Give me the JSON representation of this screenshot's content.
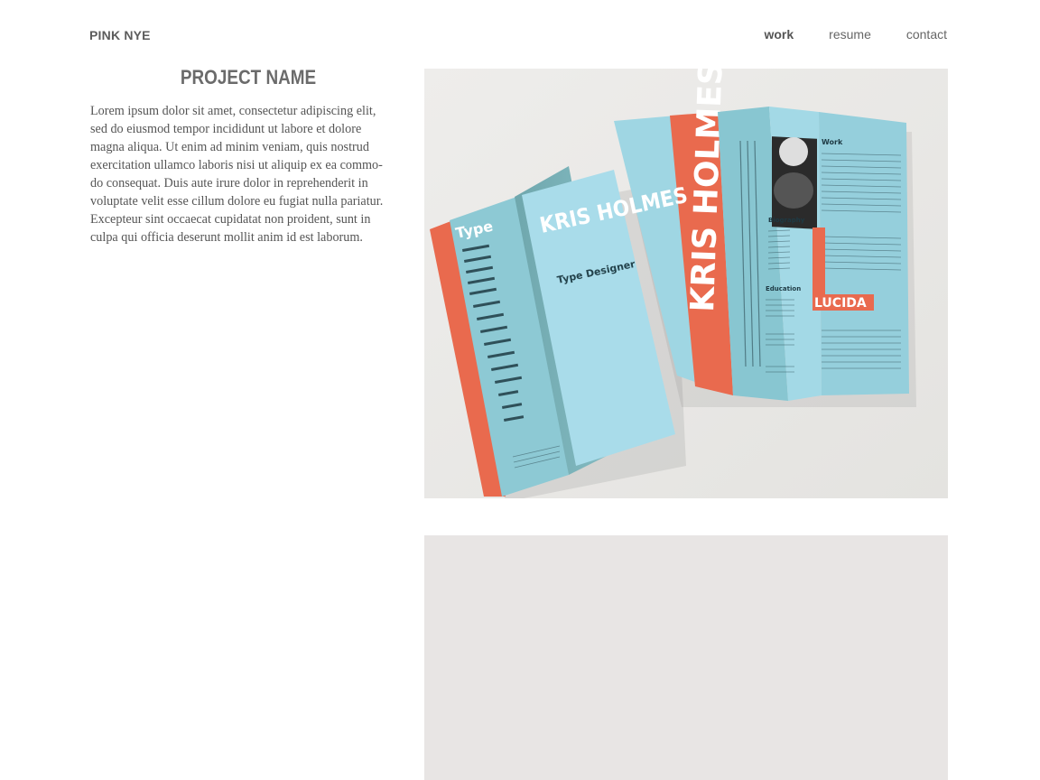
{
  "header": {
    "logo": "PINK NYE",
    "nav": [
      {
        "label": "work",
        "active": true
      },
      {
        "label": "resume",
        "active": false
      },
      {
        "label": "contact",
        "active": false
      }
    ]
  },
  "project": {
    "title": "PROJECT NAME",
    "description": "Lorem ipsum dolor sit amet, consectetur adipiscing elit, sed do eiusmod tempor incididunt ut labore et dolore magna aliqua. Ut enim ad minim veniam, quis nostrud exercitation ullamco laboris nisi ut aliquip ex ea commo-do consequat. Duis aute irure dolor in reprehenderit in voluptate velit esse cillum dolore eu fugiat nulla pariatur. Excepteur sint occaecat cupidatat non proident, sunt in culpa qui officia deserunt mollit anim id est laborum.",
    "image_1_text": {
      "brochure_front_name": "KRIS HOLMES",
      "brochure_front_subtitle": "Type Designer",
      "brochure_spine_label": "Type",
      "brochure_inside_name": "KRIS HOLMES",
      "brochure_section_work": "Work",
      "brochure_section_biography": "Biography",
      "brochure_section_education": "Education",
      "brochure_feature": "LUCIDA"
    }
  },
  "colors": {
    "text_gray": "#555555",
    "brochure_blue": "#9dd6e4",
    "brochure_orange": "#e8674c",
    "placeholder_bg": "#e8e5e4"
  }
}
